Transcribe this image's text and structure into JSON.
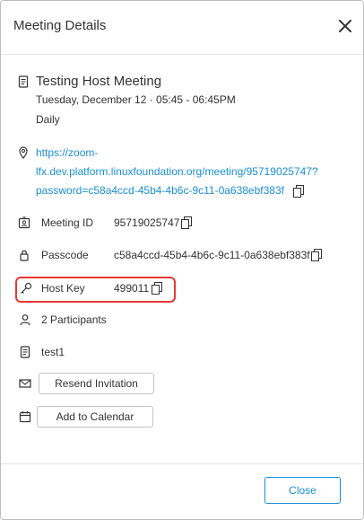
{
  "dialog": {
    "title": "Meeting Details",
    "close_icon": "close-icon"
  },
  "meeting": {
    "title": "Testing Host Meeting",
    "datetime": "Tuesday, December 12 · 05:45 - 06:45PM",
    "recurrence": "Daily",
    "link_line1": "https://zoom-",
    "link_line2": "lfx.dev.platform.linuxfoundation.org/meeting/95719025747?",
    "link_line3": "password=c58a4ccd-45b4-4b6c-9c11-0a638ebf383f",
    "meeting_id_label": "Meeting ID",
    "meeting_id_value": "95719025747",
    "passcode_label": "Passcode",
    "passcode_value": "c58a4ccd-45b4-4b6c-9c11-0a638ebf383f",
    "host_key_label": "Host Key",
    "host_key_value": "499011",
    "participants": "2 Participants",
    "description": "test1"
  },
  "actions": {
    "resend_label": "Resend Invitation",
    "calendar_label": "Add to Calendar",
    "close_label": "Close"
  },
  "colors": {
    "accent": "#1a8fd6",
    "highlight": "#e53935",
    "text": "#333333"
  },
  "icons": {
    "title": "document-icon",
    "link": "location-pin-icon",
    "meeting_id": "id-badge-icon",
    "passcode": "lock-icon",
    "host_key": "key-icon",
    "participants": "person-icon",
    "description": "note-icon",
    "resend": "envelope-icon",
    "calendar": "calendar-icon",
    "copy": "copy-icon"
  }
}
